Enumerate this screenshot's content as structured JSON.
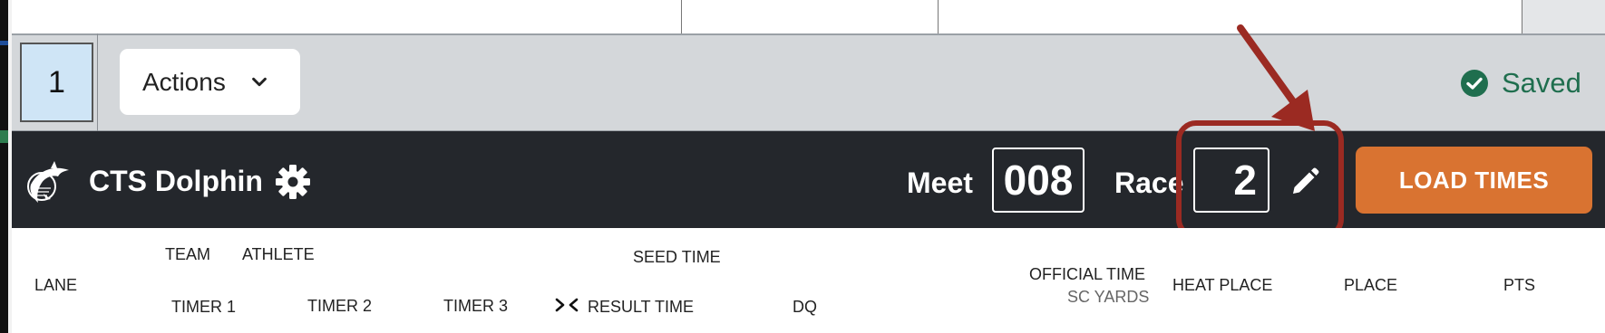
{
  "toolbar": {
    "sheet_number": "1",
    "actions_label": "Actions",
    "saved_label": "Saved"
  },
  "header": {
    "app_title": "CTS Dolphin",
    "meet_label": "Meet",
    "meet_value": "008",
    "race_label": "Race",
    "race_value": "2",
    "load_times_label": "LOAD TIMES"
  },
  "columns": {
    "lane": "LANE",
    "team": "TEAM",
    "athlete": "ATHLETE",
    "seed_time": "SEED TIME",
    "timer1": "TIMER 1",
    "timer2": "TIMER 2",
    "timer3": "TIMER 3",
    "result_time": "RESULT TIME",
    "dq": "DQ",
    "official_time": "OFFICIAL TIME",
    "official_units": "SC YARDS",
    "heat_place": "HEAT PLACE",
    "place": "PLACE",
    "pts": "PTS"
  },
  "icons": {
    "actions": "chevron-down-icon",
    "saved": "check-circle-icon",
    "logo": "dolphin-logo",
    "settings": "gear-icon",
    "race_edit": "pencil-icon",
    "result_swap": "swap-icon"
  },
  "colors": {
    "header_bg": "#24272c",
    "load_button": "#d97331",
    "saved_green": "#1f6e4e",
    "annotation_red": "#9b2a22",
    "sheet_cell": "#cfe5f6"
  }
}
